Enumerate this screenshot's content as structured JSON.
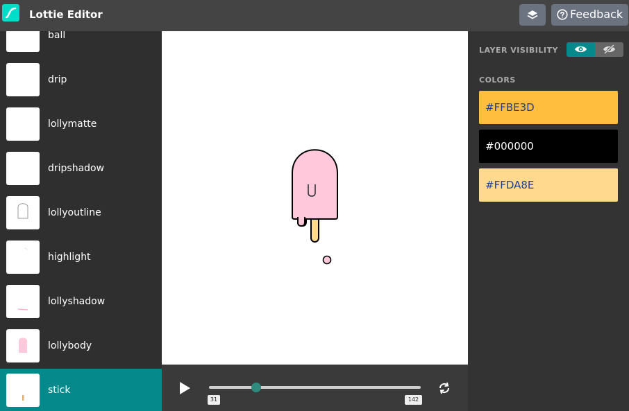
{
  "header": {
    "app_title": "Lottie Editor",
    "feedback_label": "Feedback",
    "logo_icon": "lottie-logo-icon",
    "layers_icon": "layers-icon"
  },
  "layers": [
    {
      "name": "ball",
      "thumb": "blank"
    },
    {
      "name": "drip",
      "thumb": "blank"
    },
    {
      "name": "lollymatte",
      "thumb": "blank"
    },
    {
      "name": "dripshadow",
      "thumb": "blank"
    },
    {
      "name": "lollyoutline",
      "thumb": "outline"
    },
    {
      "name": "highlight",
      "thumb": "highlight"
    },
    {
      "name": "lollyshadow",
      "thumb": "shadow"
    },
    {
      "name": "lollybody",
      "thumb": "body"
    },
    {
      "name": "stick",
      "thumb": "stick",
      "active": true
    }
  ],
  "player": {
    "play_icon": "play-icon",
    "loop_icon": "loop-icon",
    "start_frame": "31",
    "end_frame": "142"
  },
  "panel": {
    "visibility_title": "LAYER VISIBILITY",
    "colors_title": "COLORS",
    "visibility_on_icon": "eye-icon",
    "visibility_off_icon": "eye-slash-icon",
    "colors": [
      {
        "label": "#FFBE3D",
        "hex": "#FFBE3D",
        "text_color": "#1f3f8a"
      },
      {
        "label": "#000000",
        "hex": "#000000",
        "text_color": "#ffffff"
      },
      {
        "label": "#FFDA8E",
        "hex": "#FFDA8E",
        "text_color": "#1f3f8a"
      }
    ]
  },
  "colors": {
    "accent": "#05898a",
    "topbar": "#444444",
    "sidebar": "#2f2f2f",
    "lolly_pink": "#FFC9DB",
    "stick": "#FFDA8E"
  }
}
